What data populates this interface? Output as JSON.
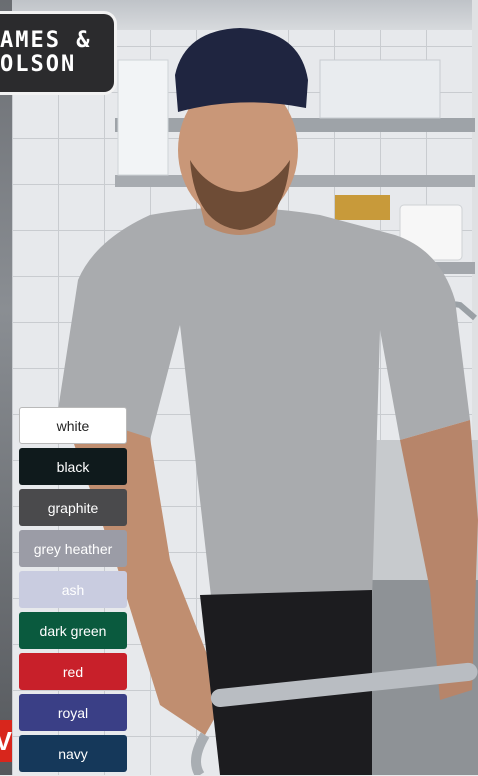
{
  "logo": {
    "line1": "AMES &",
    "line2": "OLSON"
  },
  "badge": {
    "text": "V"
  },
  "colors": [
    {
      "label": "white",
      "hex": "#ffffff"
    },
    {
      "label": "black",
      "hex": "#0f1a1c"
    },
    {
      "label": "graphite",
      "hex": "#4a4a4c"
    },
    {
      "label": "grey heather",
      "hex": "#9b9ca6"
    },
    {
      "label": "ash",
      "hex": "#c9cce0"
    },
    {
      "label": "dark green",
      "hex": "#0a5a3e"
    },
    {
      "label": "red",
      "hex": "#c8202a"
    },
    {
      "label": "royal",
      "hex": "#3a3f86"
    },
    {
      "label": "navy",
      "hex": "#15385a"
    }
  ]
}
